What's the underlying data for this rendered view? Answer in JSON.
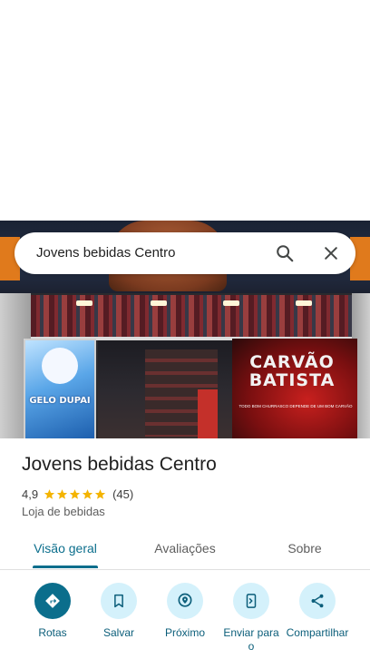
{
  "search": {
    "query": "Jovens bebidas Centro"
  },
  "photo": {
    "panel_left_text": "GELO DUPAI",
    "panel_right_title": "CARVÃO BATISTA",
    "panel_right_subtitle": "TODO BOM CHURRASCO DEPENDE DE UM BOM CARVÃO"
  },
  "place": {
    "name": "Jovens bebidas Centro",
    "rating": "4,9",
    "stars_value": 4.9,
    "review_count": "(45)",
    "category": "Loja de bebidas"
  },
  "tabs": [
    {
      "label": "Visão geral",
      "active": true
    },
    {
      "label": "Avaliações",
      "active": false
    },
    {
      "label": "Sobre",
      "active": false
    }
  ],
  "actions": [
    {
      "label": "Rotas",
      "icon": "directions-icon"
    },
    {
      "label": "Salvar",
      "icon": "bookmark-icon"
    },
    {
      "label": "Próximo",
      "icon": "nearby-icon"
    },
    {
      "label": "Enviar para o",
      "icon": "send-to-phone-icon"
    },
    {
      "label": "Compartilhar",
      "icon": "share-icon"
    }
  ],
  "colors": {
    "accent": "#0b6e8c",
    "accent_light": "#d4f1fb",
    "star": "#f4b400"
  }
}
